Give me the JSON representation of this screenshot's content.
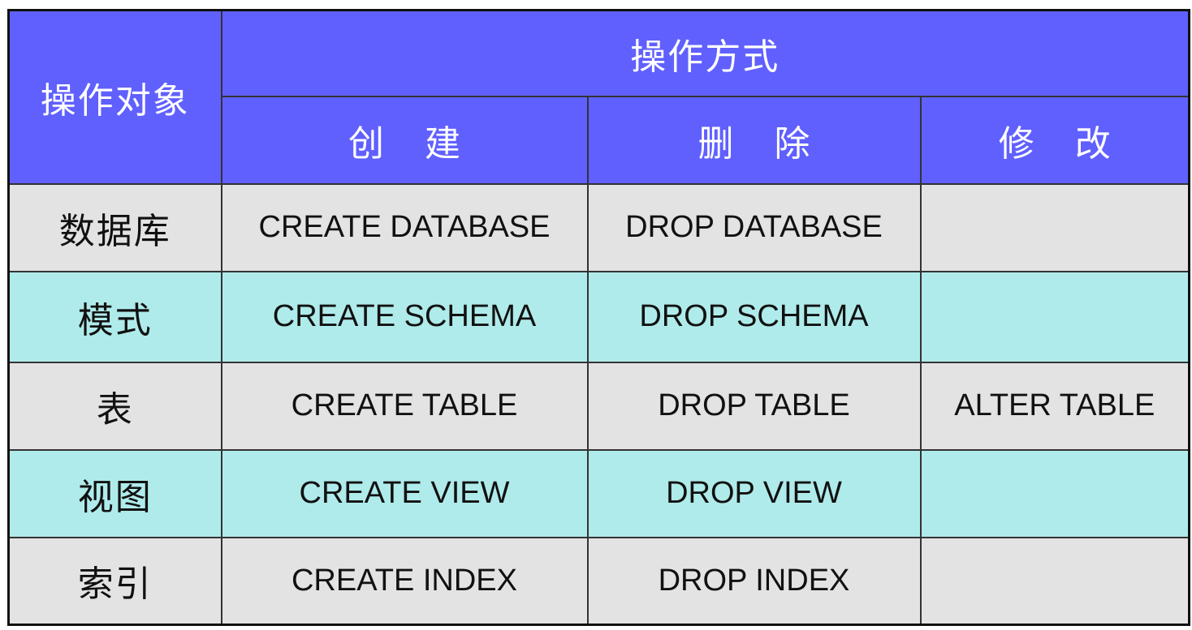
{
  "table": {
    "header": {
      "object_label": "操作对象",
      "method_label": "操作方式",
      "columns": [
        "创 建",
        "删 除",
        "修 改"
      ]
    },
    "rows": [
      {
        "object": "数据库",
        "create": "CREATE DATABASE",
        "drop": "DROP DATABASE",
        "alter": ""
      },
      {
        "object": "模式",
        "create": "CREATE SCHEMA",
        "drop": "DROP SCHEMA",
        "alter": ""
      },
      {
        "object": "表",
        "create": "CREATE TABLE",
        "drop": "DROP TABLE",
        "alter": "ALTER TABLE"
      },
      {
        "object": "视图",
        "create": "CREATE VIEW",
        "drop": "DROP VIEW",
        "alter": ""
      },
      {
        "object": "索引",
        "create": "CREATE  INDEX",
        "drop": "DROP INDEX",
        "alter": ""
      }
    ],
    "colors": {
      "header_bg": "#6060ff",
      "row_gray": "#e3e3e3",
      "row_cyan": "#b0ebeb"
    }
  }
}
